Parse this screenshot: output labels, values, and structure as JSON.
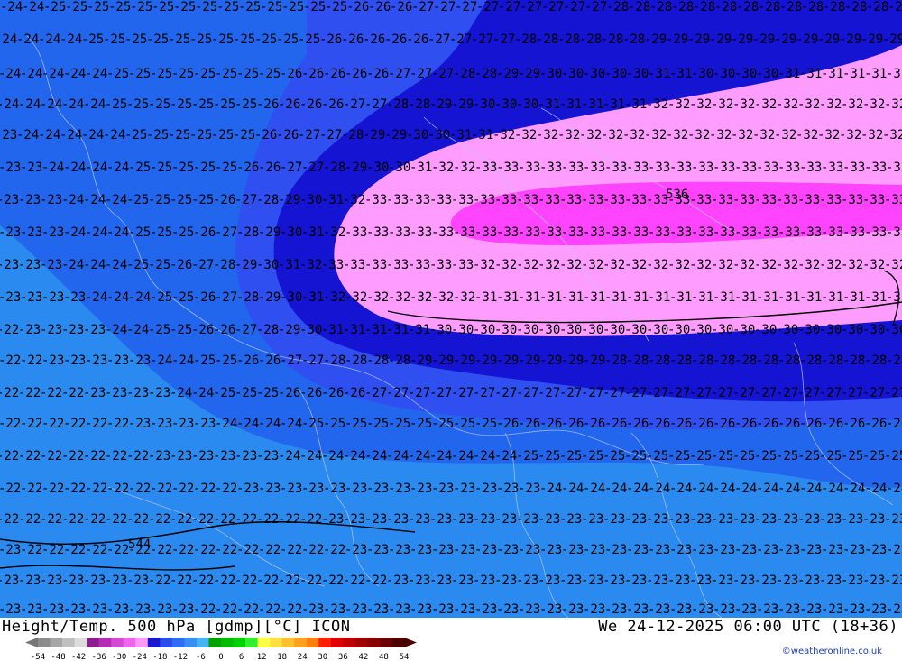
{
  "map": {
    "contour_labels": {
      "c22": "22",
      "c23": "23",
      "c24": "24",
      "c25": "25",
      "c26": "26",
      "c27": "27",
      "c28": "28",
      "c29": "29",
      "c30": "30",
      "c31": "31",
      "c32": "32",
      "c33": "33"
    },
    "high_marker": "536",
    "low_marker": "544",
    "colors": {
      "band_22": "#2a8af0",
      "band_24": "#2266ee",
      "band_26": "#2f4ff0",
      "band_28": "#1414d2",
      "band_30": "#ff9cff",
      "band_32": "#ff44ff",
      "contour": "#000000",
      "border": "#b9c8ea"
    }
  },
  "footer": {
    "title": "Height/Temp. 500 hPa [gdmp][°C] ICON",
    "datetime": "We 24-12-2025 06:00 UTC (18+36)",
    "credit": "©weatheronline.co.uk",
    "scale_labels": [
      "-54",
      "-48",
      "-42",
      "-36",
      "-30",
      "-24",
      "-18",
      "-12",
      "-6",
      "0",
      "6",
      "12",
      "18",
      "24",
      "30",
      "36",
      "42",
      "48",
      "54"
    ],
    "scale_colors": [
      "#8c8c8c",
      "#a6a6a6",
      "#c0c0c0",
      "#dcdcdc",
      "#8a1e8a",
      "#b42cb4",
      "#d24ad2",
      "#ee66ee",
      "#ff99ff",
      "#1818d0",
      "#2a4df0",
      "#2f6ef4",
      "#3a8ef0",
      "#44b4f4",
      "#00a000",
      "#00bb00",
      "#00d200",
      "#30ee30",
      "#ffff44",
      "#ffe040",
      "#ffc030",
      "#ffa020",
      "#ff8010",
      "#ff2000",
      "#e00000",
      "#c00000",
      "#a00000",
      "#880000",
      "#6a0000",
      "#4a0000"
    ]
  }
}
